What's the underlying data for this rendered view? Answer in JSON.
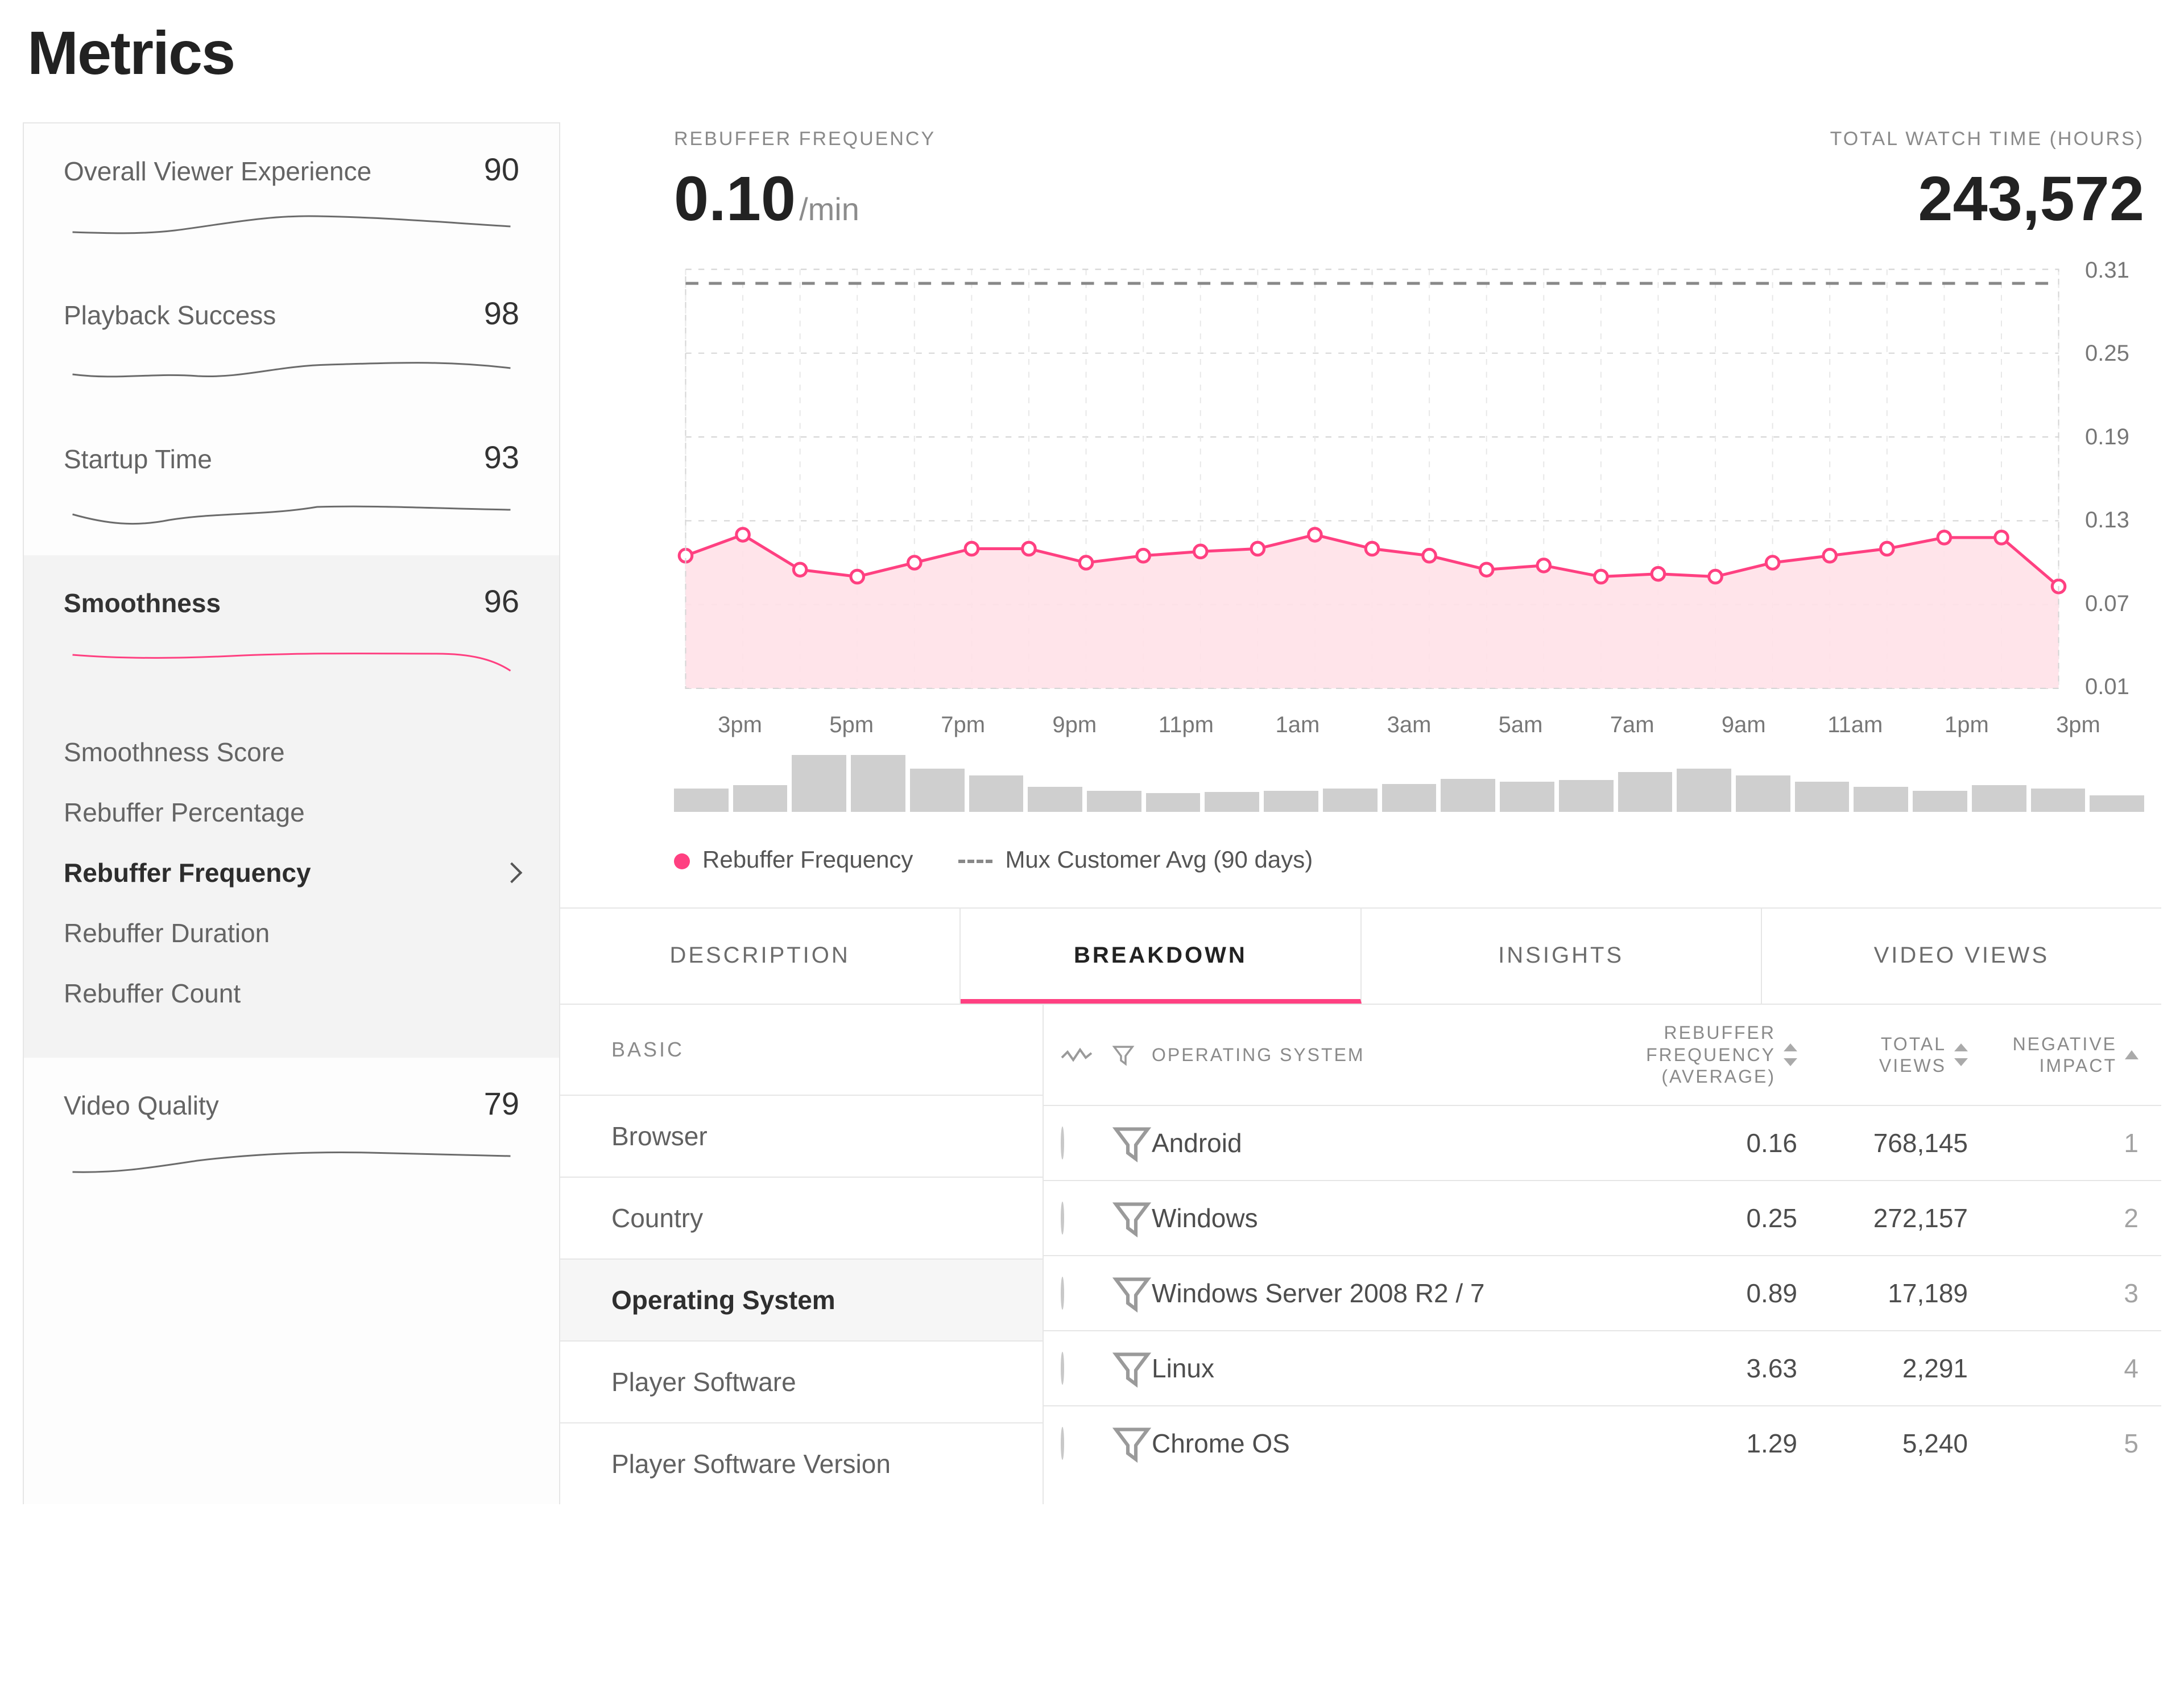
{
  "title": "Metrics",
  "sidebar": {
    "items": [
      {
        "name": "Overall Viewer Experience",
        "value": "90"
      },
      {
        "name": "Playback Success",
        "value": "98"
      },
      {
        "name": "Startup Time",
        "value": "93"
      },
      {
        "name": "Smoothness",
        "value": "96"
      },
      {
        "name": "Video Quality",
        "value": "79"
      }
    ],
    "active_index": 3,
    "subitems": [
      "Smoothness Score",
      "Rebuffer Percentage",
      "Rebuffer Frequency",
      "Rebuffer Duration",
      "Rebuffer Count"
    ],
    "sub_active_index": 2
  },
  "summary": {
    "left_label": "REBUFFER FREQUENCY",
    "left_value": "0.10",
    "left_unit": "/min",
    "right_label": "TOTAL WATCH TIME (HOURS)",
    "right_value": "243,572"
  },
  "chart_data": {
    "type": "area",
    "title": "",
    "xlabel": "",
    "ylabel": "",
    "ylim": [
      0.01,
      0.31
    ],
    "y_ticks": [
      0.31,
      0.25,
      0.19,
      0.13,
      0.07,
      0.01
    ],
    "customer_avg": 0.3,
    "x_ticks": [
      "3pm",
      "5pm",
      "7pm",
      "9pm",
      "11pm",
      "1am",
      "3am",
      "5am",
      "7am",
      "9am",
      "11am",
      "1pm",
      "3pm"
    ],
    "x": [
      "3pm",
      "4pm",
      "5pm",
      "6pm",
      "7pm",
      "8pm",
      "9pm",
      "10pm",
      "11pm",
      "12am",
      "1am",
      "2am",
      "3am",
      "4am",
      "5am",
      "6am",
      "7am",
      "8am",
      "9am",
      "10am",
      "11am",
      "12pm",
      "1pm",
      "2pm",
      "3pm"
    ],
    "series": [
      {
        "name": "Rebuffer Frequency",
        "values": [
          0.105,
          0.12,
          0.095,
          0.09,
          0.1,
          0.11,
          0.11,
          0.1,
          0.105,
          0.108,
          0.11,
          0.12,
          0.11,
          0.105,
          0.095,
          0.098,
          0.09,
          0.092,
          0.09,
          0.1,
          0.105,
          0.11,
          0.118,
          0.118,
          0.083
        ]
      },
      {
        "name": "Mux Customer Avg (90 days)",
        "values": [
          0.3,
          0.3,
          0.3,
          0.3,
          0.3,
          0.3,
          0.3,
          0.3,
          0.3,
          0.3,
          0.3,
          0.3,
          0.3,
          0.3,
          0.3,
          0.3,
          0.3,
          0.3,
          0.3,
          0.3,
          0.3,
          0.3,
          0.3,
          0.3,
          0.3
        ]
      }
    ],
    "volume": [
      35,
      40,
      85,
      85,
      65,
      55,
      38,
      32,
      28,
      30,
      32,
      35,
      42,
      50,
      45,
      48,
      60,
      65,
      55,
      45,
      38,
      32,
      40,
      35,
      25
    ]
  },
  "legend": {
    "a": "Rebuffer Frequency",
    "b": "Mux Customer Avg (90 days)"
  },
  "tabs": {
    "items": [
      "DESCRIPTION",
      "BREAKDOWN",
      "INSIGHTS",
      "VIDEO VIEWS"
    ],
    "active": 1
  },
  "breakdown": {
    "basic_label": "BASIC",
    "basic_items": [
      "Browser",
      "Country",
      "Operating System",
      "Player Software",
      "Player Software Version"
    ],
    "basic_active": 2,
    "columns": {
      "dim": "OPERATING SYSTEM",
      "c1": "REBUFFER\nFREQUENCY\n(AVERAGE)",
      "c2": "TOTAL\nVIEWS",
      "c3": "NEGATIVE\nIMPACT"
    },
    "rows": [
      {
        "name": "Android",
        "freq": "0.16",
        "views": "768,145",
        "impact": "1"
      },
      {
        "name": "Windows",
        "freq": "0.25",
        "views": "272,157",
        "impact": "2"
      },
      {
        "name": "Windows Server 2008 R2 / 7",
        "freq": "0.89",
        "views": "17,189",
        "impact": "3"
      },
      {
        "name": "Linux",
        "freq": "3.63",
        "views": "2,291",
        "impact": "4"
      },
      {
        "name": "Chrome OS",
        "freq": "1.29",
        "views": "5,240",
        "impact": "5"
      }
    ]
  }
}
